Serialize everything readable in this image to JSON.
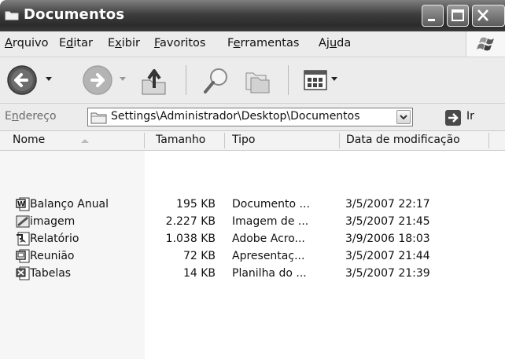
{
  "window": {
    "title": "Documentos"
  },
  "menu": [
    {
      "pre": "",
      "key": "A",
      "post": "rquivo"
    },
    {
      "pre": "E",
      "key": "d",
      "post": "itar"
    },
    {
      "pre": "E",
      "key": "x",
      "post": "ibir"
    },
    {
      "pre": "",
      "key": "F",
      "post": "avoritos"
    },
    {
      "pre": "F",
      "key": "e",
      "post": "rramentas"
    },
    {
      "pre": "Aj",
      "key": "u",
      "post": "da"
    }
  ],
  "toolbar": {
    "back_icon": "back-arrow-icon",
    "forward_icon": "forward-arrow-icon",
    "up_icon": "up-folder-icon",
    "search_icon": "search-icon",
    "folders_icon": "folders-icon",
    "views_icon": "views-icon"
  },
  "address": {
    "label_pre": "E",
    "label_key": "n",
    "label_post": "dereço",
    "value": "Settings\\Administrador\\Desktop\\Documentos",
    "go_label": "Ir"
  },
  "columns": {
    "name": "Nome",
    "size": "Tamanho",
    "type": "Tipo",
    "modified": "Data de modificação"
  },
  "files": [
    {
      "name": "Balanço Anual",
      "size": "195 KB",
      "type": "Documento ...",
      "modified": "3/5/2007 22:17",
      "icon": "word-document-icon"
    },
    {
      "name": "imagem",
      "size": "2.227 KB",
      "type": "Imagem de ...",
      "modified": "3/5/2007 21:45",
      "icon": "image-file-icon"
    },
    {
      "name": "Relatório",
      "size": "1.038 KB",
      "type": "Adobe Acro...",
      "modified": "3/9/2006 18:03",
      "icon": "pdf-file-icon"
    },
    {
      "name": "Reunião",
      "size": "72 KB",
      "type": "Apresentaç...",
      "modified": "3/5/2007 21:44",
      "icon": "presentation-file-icon"
    },
    {
      "name": "Tabelas",
      "size": "14 KB",
      "type": "Planilha do ...",
      "modified": "3/5/2007 21:39",
      "icon": "spreadsheet-file-icon"
    }
  ]
}
